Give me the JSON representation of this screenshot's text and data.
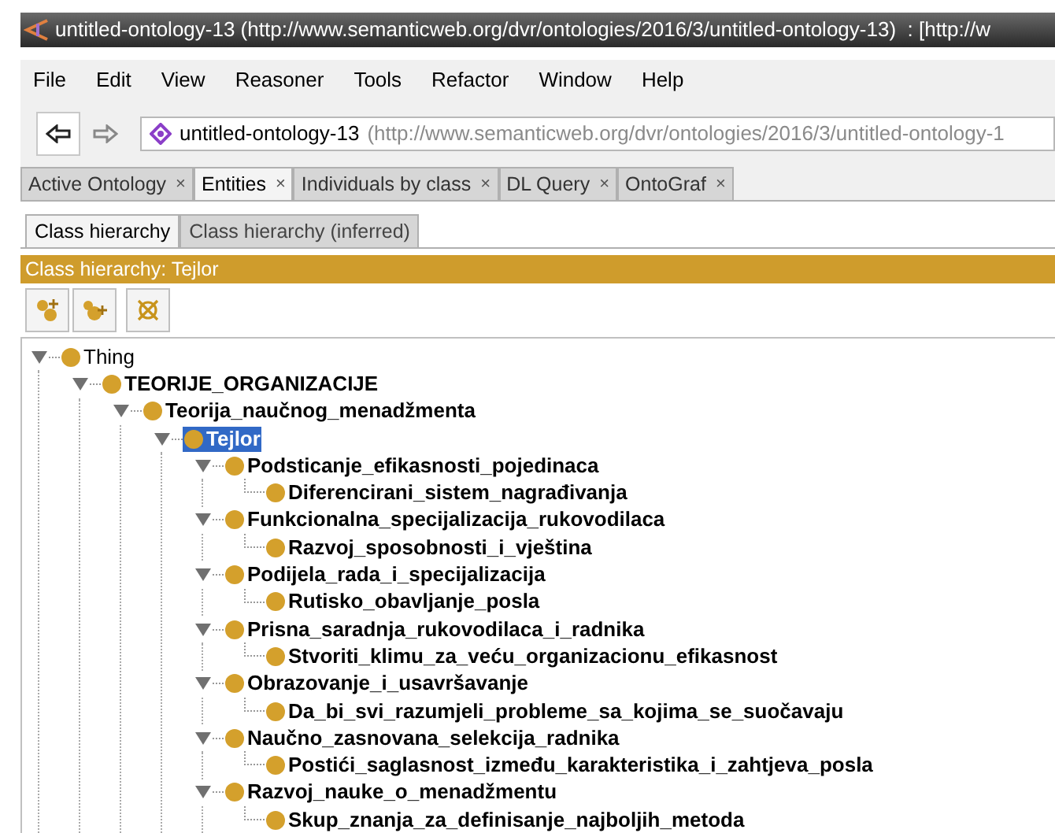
{
  "window": {
    "title": "untitled-ontology-13 (http://www.semanticweb.org/dvr/ontologies/2016/3/untitled-ontology-13)  : [http://w"
  },
  "menu": [
    "File",
    "Edit",
    "View",
    "Reasoner",
    "Tools",
    "Refactor",
    "Window",
    "Help"
  ],
  "address": {
    "name": "untitled-ontology-13",
    "iri": "(http://www.semanticweb.org/dvr/ontologies/2016/3/untitled-ontology-1"
  },
  "tabs": [
    {
      "label": "Active Ontology",
      "selected": false
    },
    {
      "label": "Entities",
      "selected": true
    },
    {
      "label": "Individuals by class",
      "selected": false
    },
    {
      "label": "DL Query",
      "selected": false
    },
    {
      "label": "OntoGraf",
      "selected": false
    }
  ],
  "close_glyph": "×",
  "subtabs": [
    {
      "label": "Class hierarchy",
      "selected": true
    },
    {
      "label": "Class hierarchy (inferred)",
      "selected": false
    }
  ],
  "panel_title": "Class hierarchy: Tejlor",
  "tree": [
    {
      "label": "Thing",
      "bold": false,
      "selected": false,
      "expanded": true,
      "children": [
        {
          "label": "TEORIJE_ORGANIZACIJE",
          "bold": true,
          "selected": false,
          "expanded": true,
          "children": [
            {
              "label": "Teorija_naučnog_menadžmenta",
              "bold": true,
              "selected": false,
              "expanded": true,
              "children": [
                {
                  "label": "Tejlor",
                  "bold": true,
                  "selected": true,
                  "expanded": true,
                  "children": [
                    {
                      "label": "Podsticanje_efikasnosti_pojedinaca",
                      "bold": true,
                      "selected": false,
                      "expanded": true,
                      "children": [
                        {
                          "label": "Diferencirani_sistem_nagrađivanja",
                          "bold": true,
                          "selected": false
                        }
                      ]
                    },
                    {
                      "label": "Funkcionalna_specijalizacija_rukovodilaca",
                      "bold": true,
                      "selected": false,
                      "expanded": true,
                      "children": [
                        {
                          "label": "Razvoj_sposobnosti_i_vještina",
                          "bold": true,
                          "selected": false
                        }
                      ]
                    },
                    {
                      "label": "Podijela_rada_i_specijalizacija",
                      "bold": true,
                      "selected": false,
                      "expanded": true,
                      "children": [
                        {
                          "label": "Rutisko_obavljanje_posla",
                          "bold": true,
                          "selected": false
                        }
                      ]
                    },
                    {
                      "label": "Prisna_saradnja_rukovodilaca_i_radnika",
                      "bold": true,
                      "selected": false,
                      "expanded": true,
                      "children": [
                        {
                          "label": "Stvoriti_klimu_za_veću_organizacionu_efikasnost",
                          "bold": true,
                          "selected": false
                        }
                      ]
                    },
                    {
                      "label": "Obrazovanje_i_usavršavanje",
                      "bold": true,
                      "selected": false,
                      "expanded": true,
                      "children": [
                        {
                          "label": "Da_bi_svi_razumjeli_probleme_sa_kojima_se_suočavaju",
                          "bold": true,
                          "selected": false
                        }
                      ]
                    },
                    {
                      "label": "Naučno_zasnovana_selekcija_radnika",
                      "bold": true,
                      "selected": false,
                      "expanded": true,
                      "children": [
                        {
                          "label": "Postići_saglasnost_između_karakteristika_i_zahtjeva_posla",
                          "bold": true,
                          "selected": false
                        }
                      ]
                    },
                    {
                      "label": "Razvoj_nauke_o_menadžmentu",
                      "bold": true,
                      "selected": false,
                      "expanded": true,
                      "children": [
                        {
                          "label": "Skup_znanja_za_definisanje_najboljih_metoda",
                          "bold": true,
                          "selected": false
                        }
                      ]
                    }
                  ]
                }
              ]
            }
          ]
        }
      ]
    }
  ]
}
